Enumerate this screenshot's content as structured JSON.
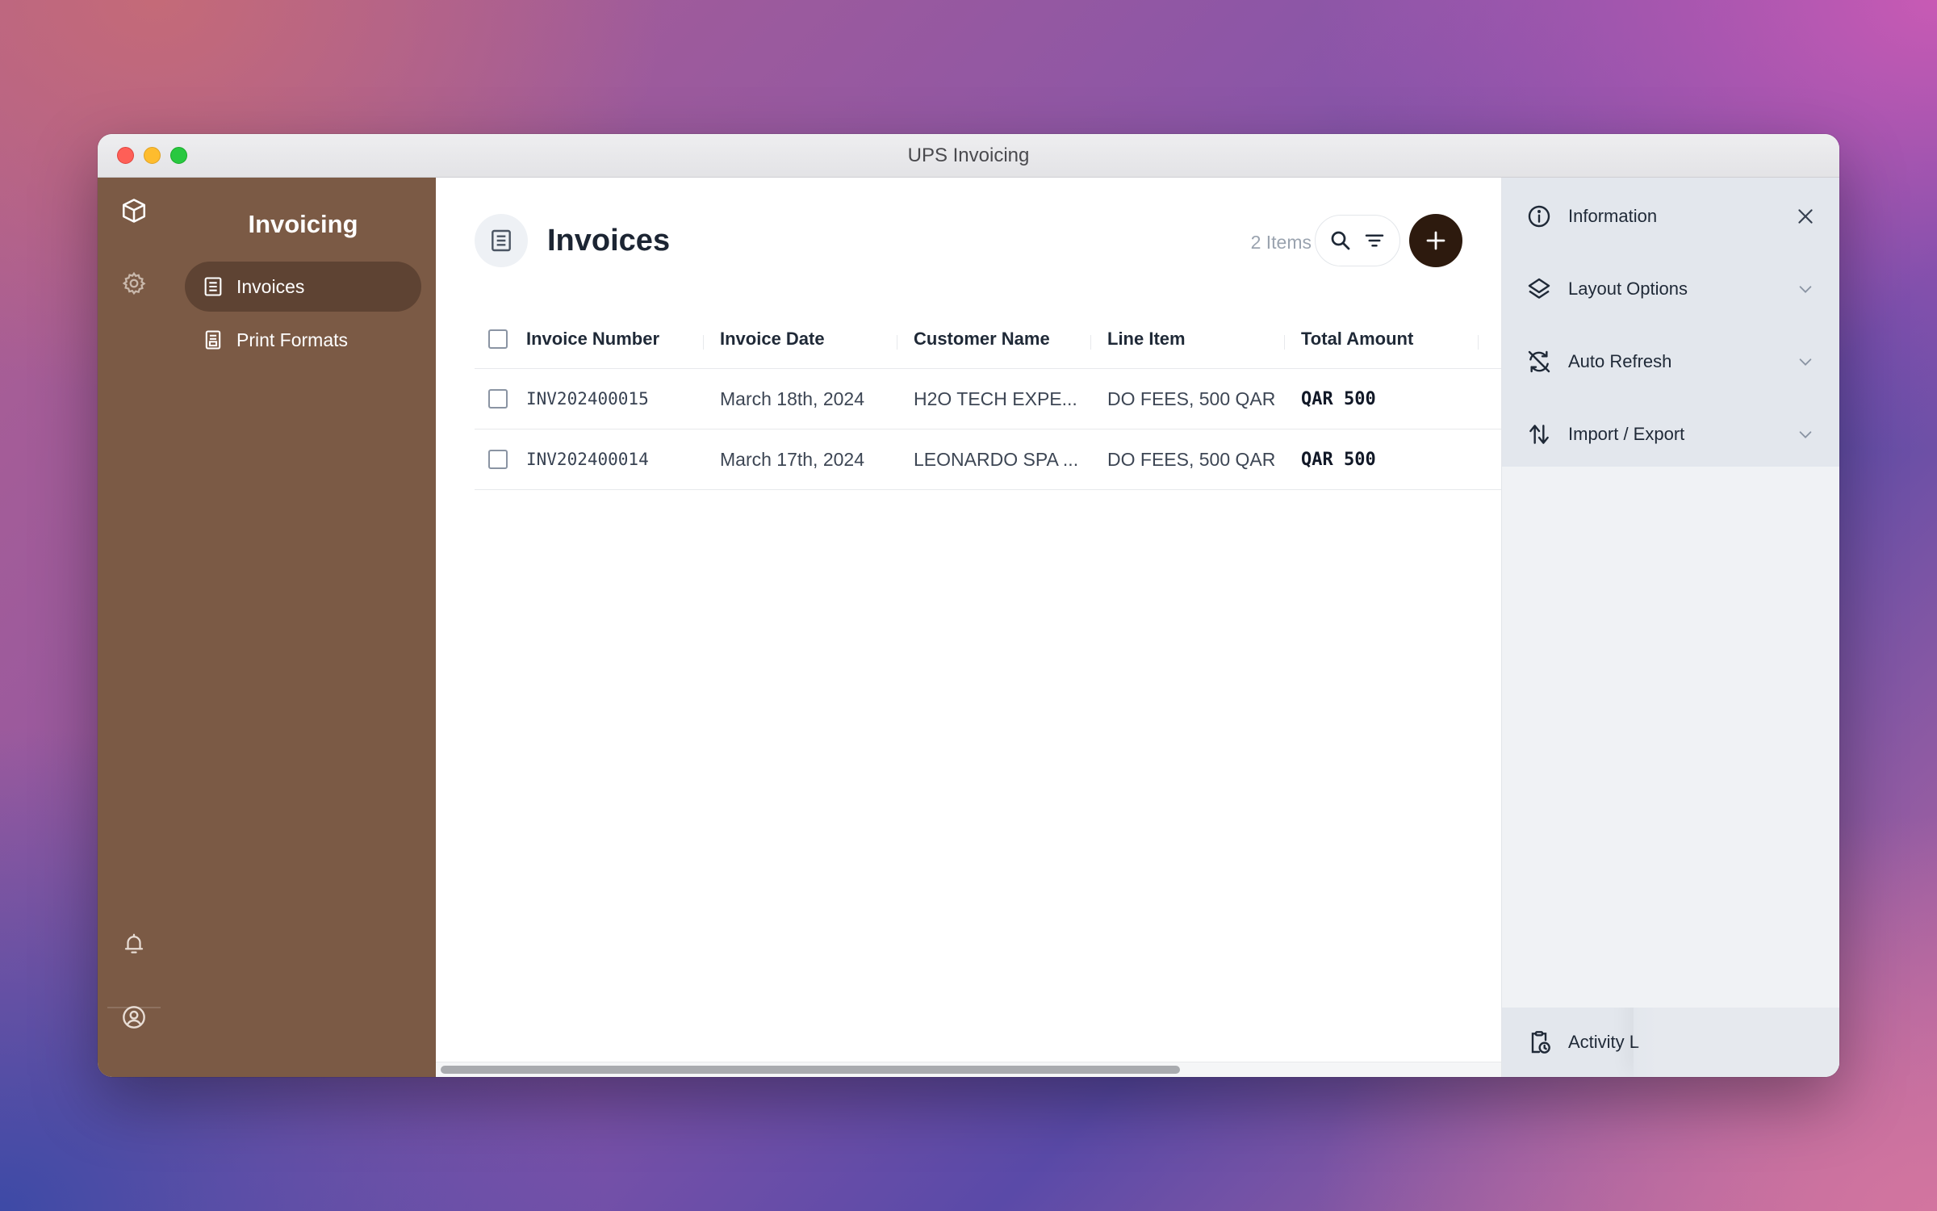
{
  "window": {
    "title": "UPS Invoicing"
  },
  "sidebar": {
    "title": "Invoicing",
    "items": [
      {
        "label": "Invoices",
        "icon": "receipt-icon",
        "active": true
      },
      {
        "label": "Print Formats",
        "icon": "document-icon",
        "active": false
      }
    ]
  },
  "rail": {
    "icons": [
      "cube-icon",
      "gear-icon",
      "bell-icon",
      "user-circle-icon"
    ]
  },
  "main": {
    "title": "Invoices",
    "item_count": "2 Items",
    "columns": [
      "Invoice Number",
      "Invoice Date",
      "Customer Name",
      "Line Item",
      "Total Amount"
    ],
    "rows": [
      {
        "number": "INV202400015",
        "date": "March 18th, 2024",
        "customer": "H2O TECH EXPE...",
        "line": "DO FEES, 500 QAR",
        "total": "QAR 500"
      },
      {
        "number": "INV202400014",
        "date": "March 17th, 2024",
        "customer": "LEONARDO SPA ...",
        "line": "DO FEES, 500 QAR",
        "total": "QAR 500"
      }
    ]
  },
  "right_panel": {
    "information": "Information",
    "layout_options": "Layout Options",
    "auto_refresh": "Auto Refresh",
    "import_export": "Import / Export",
    "activity": "Activity L"
  },
  "colors": {
    "sidebar_bg": "#7b5a45",
    "add_button": "#2d1a0e",
    "panel_bg": "#e3e7ed"
  }
}
